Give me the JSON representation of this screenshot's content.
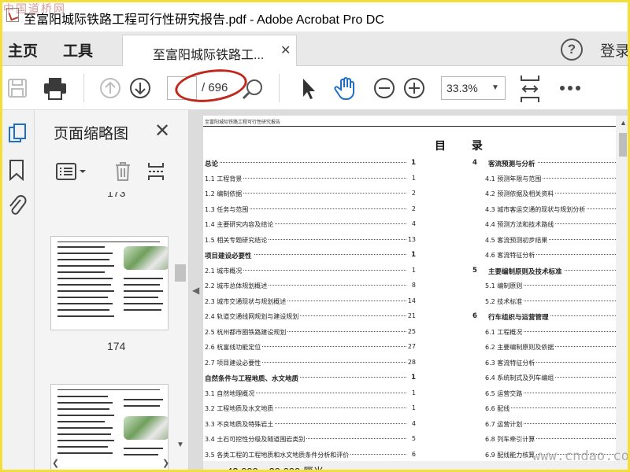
{
  "watermark_top": "中国道桥网",
  "watermark_bottom": "www.cndao.com",
  "window": {
    "title": "至富阳城际铁路工程可行性研究报告.pdf - Adobe Acrobat Pro DC"
  },
  "tabs": {
    "home": "主页",
    "tools": "工具",
    "document": "至富阳城际铁路工...",
    "help": "?",
    "login": "登录"
  },
  "toolbar": {
    "current_page": "",
    "page_total": "/ 696",
    "zoom": "33.3%"
  },
  "icons": [
    "save-icon",
    "print-icon",
    "page-up-icon",
    "page-down-icon",
    "search-page-icon",
    "select-arrow-icon",
    "hand-icon",
    "zoom-out-icon",
    "zoom-in-icon",
    "fit-page-icon",
    "more-icon"
  ],
  "panel": {
    "title": "页面缩略图",
    "partial_label_top": "173",
    "thumbnails": [
      {
        "label": "174"
      },
      {
        "label": ""
      }
    ]
  },
  "document": {
    "running_header": "至富阳城际铁路工程可行性研究报告",
    "toc_title": "目 录",
    "left_col": [
      {
        "title": "总论",
        "page": "1",
        "chapter": true
      },
      {
        "title": "1.1 工程背景",
        "page": "1"
      },
      {
        "title": "1.2 编制依据",
        "page": "2"
      },
      {
        "title": "1.3 任务与范围",
        "page": "2"
      },
      {
        "title": "1.4 主要研究内容及结论",
        "page": "4"
      },
      {
        "title": "1.5 相关专题研究结论",
        "page": "13"
      },
      {
        "title": "项目建设必要性",
        "page": "1",
        "chapter": true
      },
      {
        "title": "2.1 城市概况",
        "page": "1"
      },
      {
        "title": "2.2 城市总体规划概述",
        "page": "8"
      },
      {
        "title": "2.3 城市交通现状与规划概述",
        "page": "14"
      },
      {
        "title": "2.4 轨道交通线网规划与建设规划",
        "page": "21"
      },
      {
        "title": "2.5 杭州都市圈铁路建设规划",
        "page": "25"
      },
      {
        "title": "2.6 杭富线功能定位",
        "page": "27"
      },
      {
        "title": "2.7 项目建设必要性",
        "page": "28"
      },
      {
        "title": "自然条件与工程地质、水文地质",
        "page": "1",
        "chapter": true
      },
      {
        "title": "3.1 自然地理概况",
        "page": "1"
      },
      {
        "title": "3.2 工程地质及水文地质",
        "page": "1"
      },
      {
        "title": "3.3 不良地质及特殊岩土",
        "page": "4"
      },
      {
        "title": "3.4 土石可挖性分级及隧道围岩类别",
        "page": "5"
      },
      {
        "title": "3.5 各类工程的工程地质和水文地质条件分析和评价",
        "page": "6"
      }
    ],
    "right_col": [
      {
        "num": "4",
        "title": "客流预测与分析",
        "chapter": true
      },
      {
        "title": "4.1 预测年限与范围"
      },
      {
        "title": "4.2 预测依据及相关资料"
      },
      {
        "title": "4.3 城市客运交通的现状与规划分析"
      },
      {
        "title": "4.4 预测方法和技术路线"
      },
      {
        "title": "4.5 客流预测初步结果"
      },
      {
        "title": "4.6 客流特征分析"
      },
      {
        "num": "5",
        "title": "主要编制原则及技术标准",
        "chapter": true
      },
      {
        "title": "5.1 编制原则"
      },
      {
        "title": "5.2 技术标准"
      },
      {
        "num": "6",
        "title": "行车组织与运营管理",
        "chapter": true
      },
      {
        "title": "6.1 工程概况"
      },
      {
        "title": "6.2 主要编制原则及依据"
      },
      {
        "title": "6.3 客流特征分析"
      },
      {
        "title": "6.4 系统制式及列车编组"
      },
      {
        "title": "6.5 运营交路"
      },
      {
        "title": "6.6 配线"
      },
      {
        "title": "6.7 运营计划"
      },
      {
        "title": "6.8 列车牵引计算"
      },
      {
        "title": "6.9 配线能力核算"
      }
    ],
    "page_size": "42.000 x 29.600 厘米"
  },
  "colors": {
    "frame": "#f3de3a",
    "annotation_oval": "#c0271d",
    "hand_tool": "#1f6fc5"
  }
}
